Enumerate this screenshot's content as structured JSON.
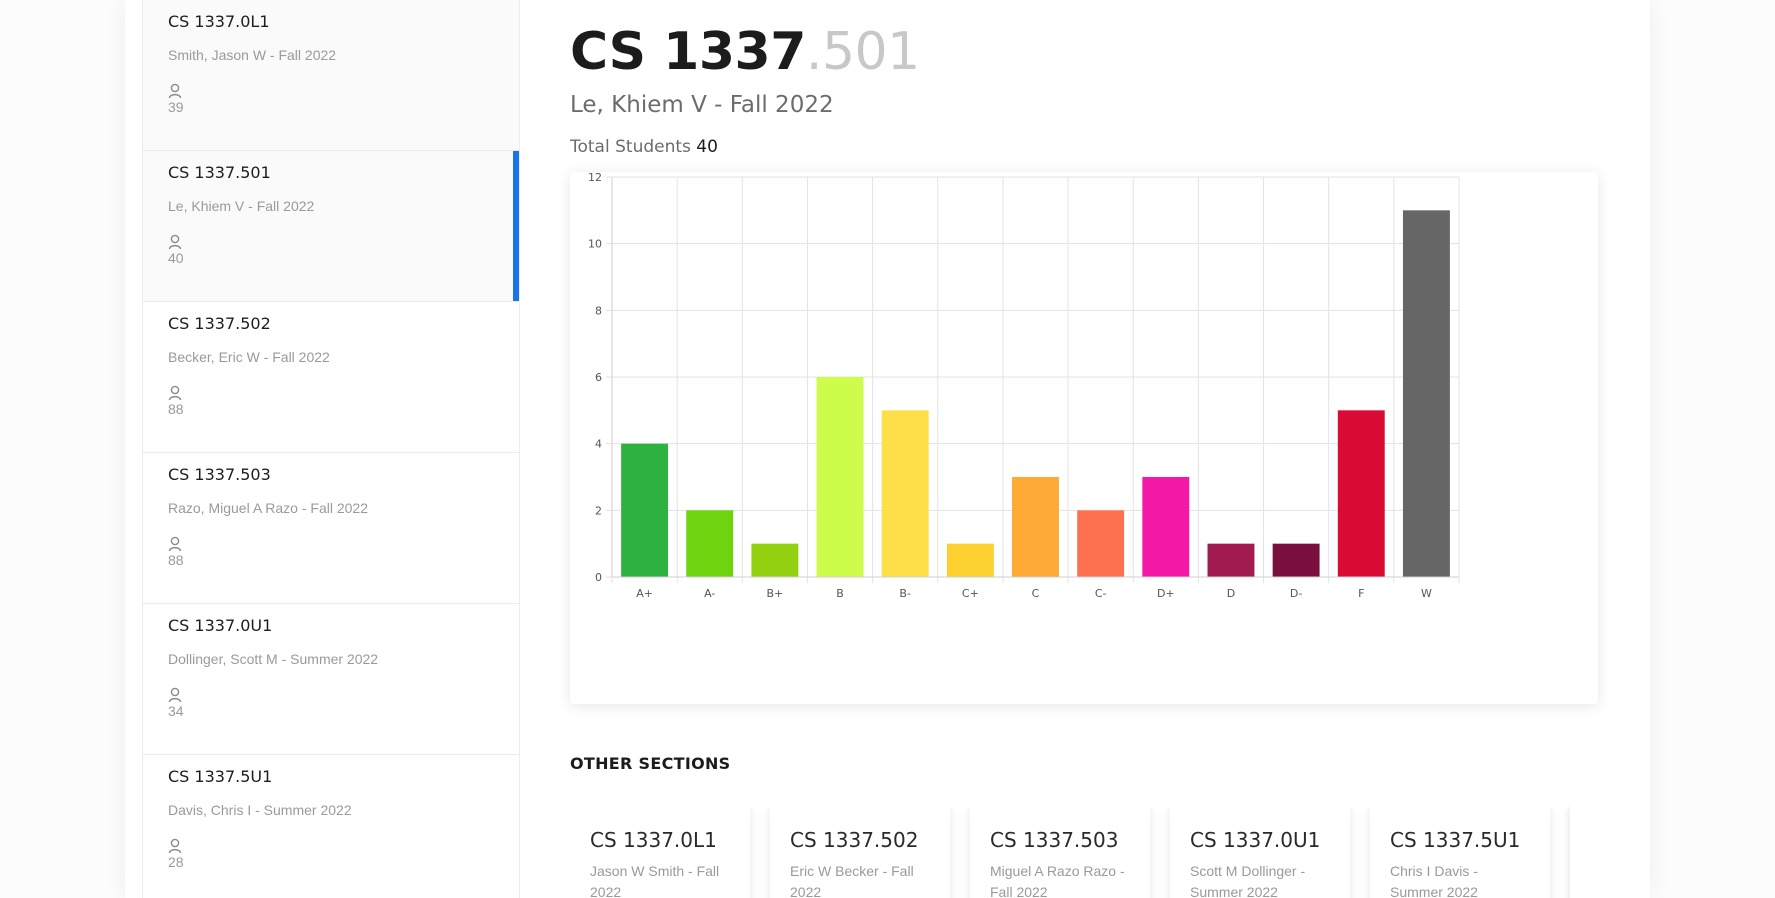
{
  "sidebar": {
    "sections": [
      {
        "code": "CS 1337.0L1",
        "subtitle": "Smith, Jason W - Fall 2022",
        "count": "39",
        "state": "dim"
      },
      {
        "code": "CS 1337.501",
        "subtitle": "Le, Khiem V - Fall 2022",
        "count": "40",
        "state": "active"
      },
      {
        "code": "CS 1337.502",
        "subtitle": "Becker, Eric W - Fall 2022",
        "count": "88",
        "state": ""
      },
      {
        "code": "CS 1337.503",
        "subtitle": "Razo, Miguel A Razo - Fall 2022",
        "count": "88",
        "state": ""
      },
      {
        "code": "CS 1337.0U1",
        "subtitle": "Dollinger, Scott M - Summer 2022",
        "count": "34",
        "state": ""
      },
      {
        "code": "CS 1337.5U1",
        "subtitle": "Davis, Chris I - Summer 2022",
        "count": "28",
        "state": ""
      }
    ]
  },
  "main": {
    "course": "CS 1337",
    "section": ".501",
    "instructor": "Le, Khiem V - Fall 2022",
    "total_label": "Total Students",
    "total_value": "40",
    "other_heading": "OTHER SECTIONS",
    "other_sections": [
      {
        "code": "CS 1337.0L1",
        "subtitle": "Jason W Smith - Fall 2022"
      },
      {
        "code": "CS 1337.502",
        "subtitle": "Eric W Becker - Fall 2022"
      },
      {
        "code": "CS 1337.503",
        "subtitle": "Miguel A Razo Razo - Fall 2022"
      },
      {
        "code": "CS 1337.0U1",
        "subtitle": "Scott M Dollinger - Summer 2022"
      },
      {
        "code": "CS 1337.5U1",
        "subtitle": "Chris I Davis - Summer 2022"
      }
    ]
  },
  "colors": {
    "accent": "#1a73e8"
  },
  "chart_data": {
    "type": "bar",
    "categories": [
      "A+",
      "A-",
      "B+",
      "B",
      "B-",
      "C+",
      "C",
      "C-",
      "D+",
      "D",
      "D-",
      "F",
      "W"
    ],
    "values": [
      4,
      2,
      1,
      6,
      5,
      1,
      3,
      2,
      3,
      1,
      1,
      5,
      11
    ],
    "colors": [
      "#2db241",
      "#6dd40f",
      "#93d00f",
      "#cdfc4a",
      "#fde049",
      "#fdd032",
      "#feaa36",
      "#fd7150",
      "#f318a7",
      "#a11b51",
      "#7a0e3c",
      "#d90b35",
      "#666666"
    ],
    "ylim": [
      0,
      12
    ],
    "yticks": [
      0,
      2,
      4,
      6,
      8,
      10,
      12
    ],
    "grid": true,
    "title": "",
    "xlabel": "",
    "ylabel": ""
  }
}
